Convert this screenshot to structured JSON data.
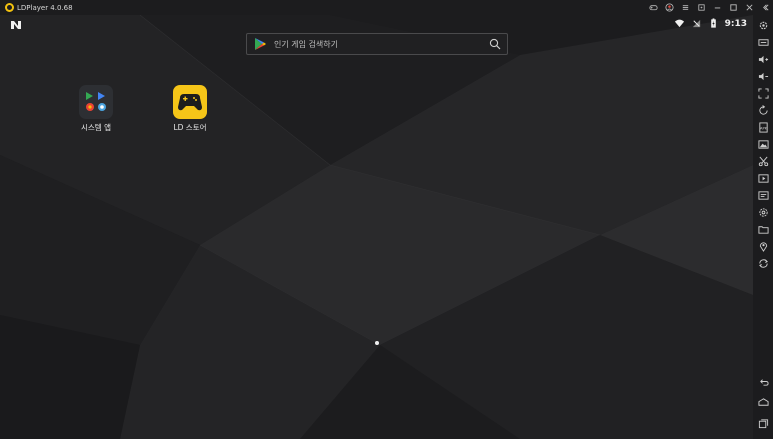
{
  "window": {
    "title": "LDPlayer 4.0.68",
    "controls": [
      "gamepad-icon",
      "account-icon",
      "menu-icon",
      "export-icon",
      "minimize-icon",
      "maximize-icon",
      "close-icon",
      "collapse-icon"
    ]
  },
  "statusbar": {
    "time": "9:13"
  },
  "search": {
    "placeholder": "인기 게임 검색하기"
  },
  "apps": [
    {
      "label": "시스템 앱",
      "icon": "system-apps-folder-icon"
    },
    {
      "label": "LD 스토어",
      "icon": "ld-store-icon"
    }
  ],
  "toolbar": {
    "items": [
      "settings-icon",
      "keyboard-icon",
      "volume-up-icon",
      "volume-down-icon",
      "fullscreen-icon",
      "rotate-icon",
      "install-apk-icon",
      "screenshot-icon",
      "record-icon",
      "multi-instance-icon",
      "sync-icon",
      "folder-icon",
      "location-icon",
      "refresh-icon",
      "back-icon",
      "home-icon",
      "recent-apps-icon"
    ]
  },
  "colors": {
    "accent": "#f5c518",
    "background": "#1b1b1d"
  }
}
